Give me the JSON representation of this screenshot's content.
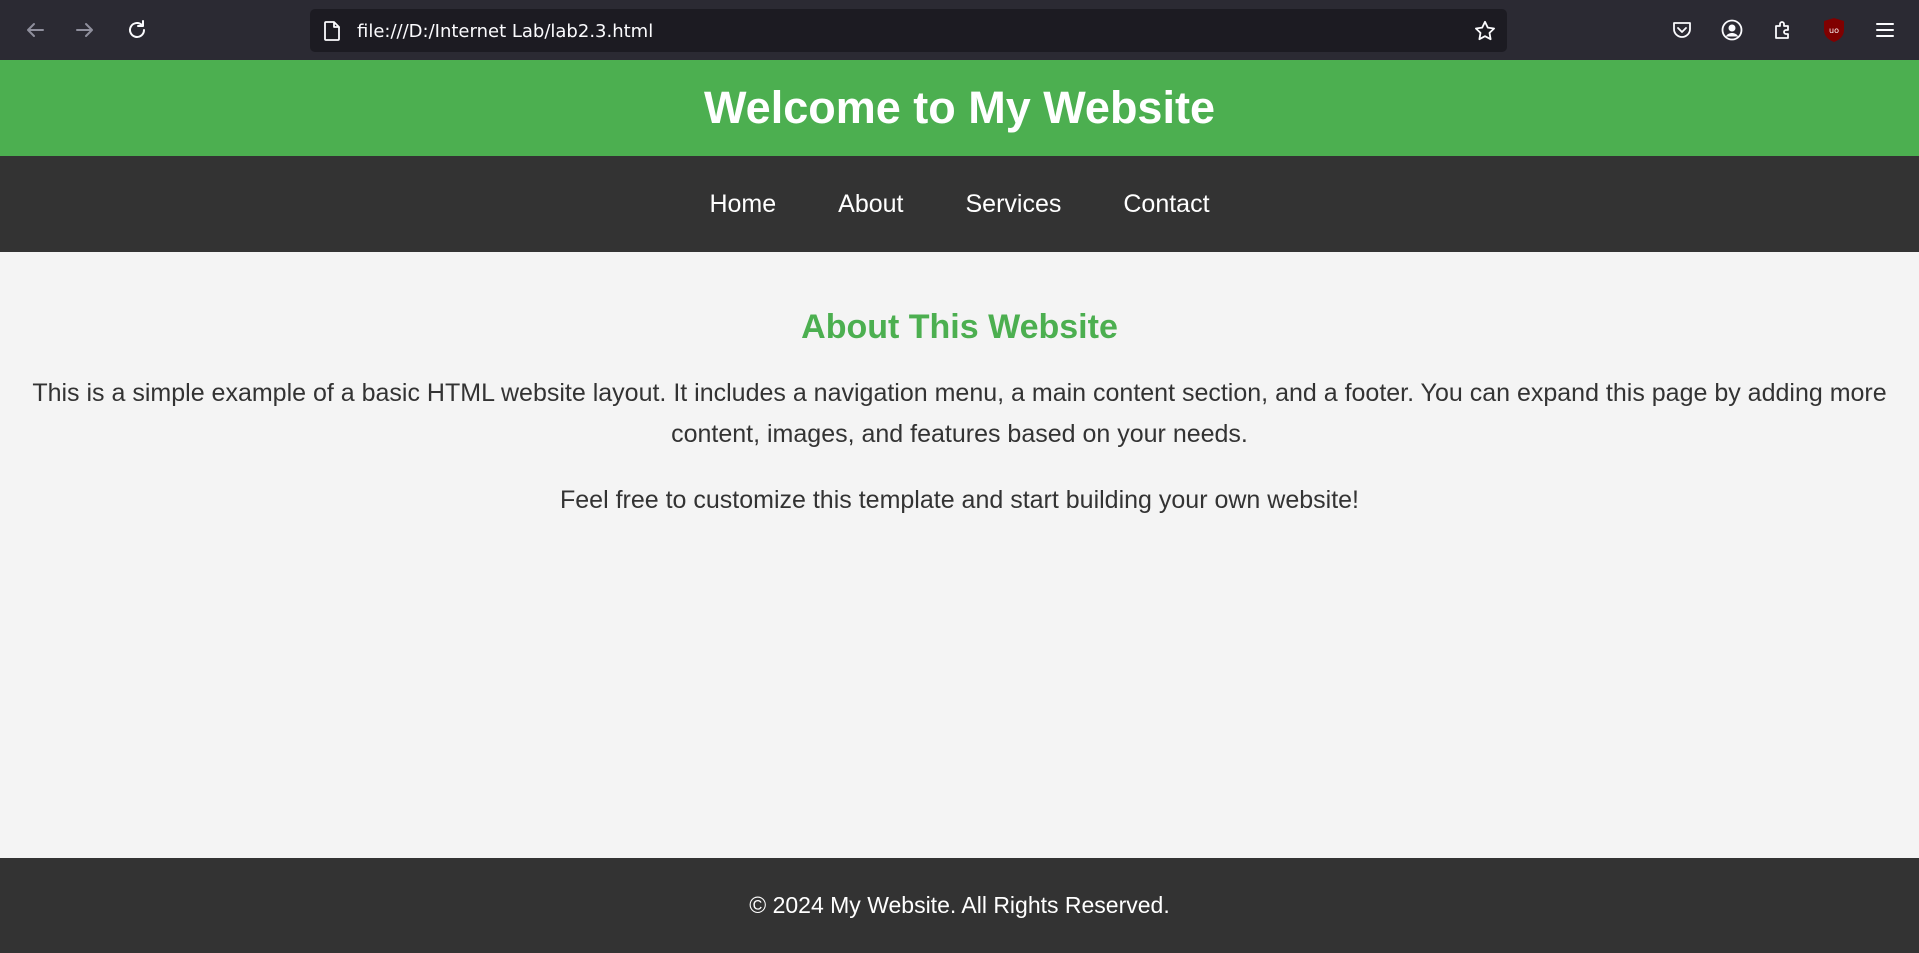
{
  "browser": {
    "url": "file:///D:/Internet Lab/lab2.3.html",
    "icons": [
      "back-arrow-icon",
      "forward-arrow-icon",
      "reload-icon",
      "page-icon",
      "star-icon",
      "pocket-icon",
      "account-icon",
      "extensions-icon",
      "ublock-icon",
      "menu-icon"
    ],
    "ublock_badge": "uo"
  },
  "header": {
    "title": "Welcome to My Website",
    "color": "#4caf50"
  },
  "nav": {
    "items": [
      {
        "label": "Home"
      },
      {
        "label": "About"
      },
      {
        "label": "Services"
      },
      {
        "label": "Contact"
      }
    ],
    "color": "#333333"
  },
  "main": {
    "heading": "About This Website",
    "paragraph1": "This is a simple example of a basic HTML website layout. It includes a navigation menu, a main content section, and a footer. You can expand this page by adding more content, images, and features based on your needs.",
    "paragraph2": "Feel free to customize this template and start building your own website!"
  },
  "footer": {
    "text": "© 2024 My Website. All Rights Reserved."
  }
}
